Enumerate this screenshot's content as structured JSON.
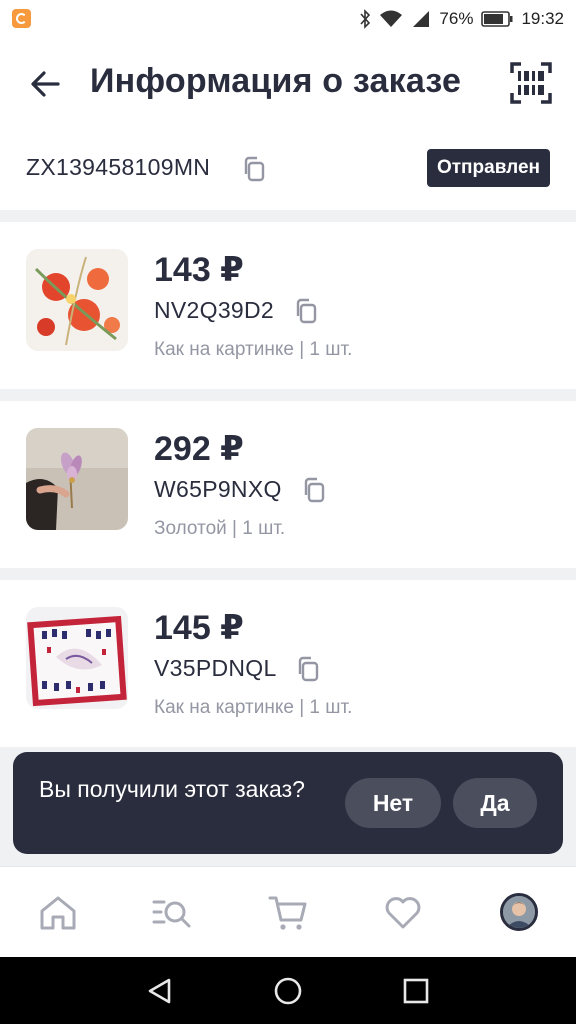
{
  "status_bar": {
    "battery": "76%",
    "time": "19:32"
  },
  "header": {
    "title": "Информация о заказе"
  },
  "order": {
    "number": "ZX139458109MN",
    "status": "Отправлен"
  },
  "items": [
    {
      "price": "143 ₽",
      "sku": "NV2Q39D2",
      "variant": "Как на картинке | 1 шт."
    },
    {
      "price": "292 ₽",
      "sku": "W65P9NXQ",
      "variant": "Золотой | 1 шт."
    },
    {
      "price": "145 ₽",
      "sku": "V35PDNQL",
      "variant": "Как на картинке | 1 шт."
    }
  ],
  "prompt": {
    "question": "Вы получили этот заказ?",
    "no": "Нет",
    "yes": "Да"
  },
  "tabs": [
    "home-icon",
    "catalog-search-icon",
    "cart-icon",
    "favorites-heart-icon",
    "profile-avatar"
  ],
  "colors": {
    "dark": "#2a2d3e",
    "muted": "#9497a3",
    "background": "#f0f1f3"
  }
}
